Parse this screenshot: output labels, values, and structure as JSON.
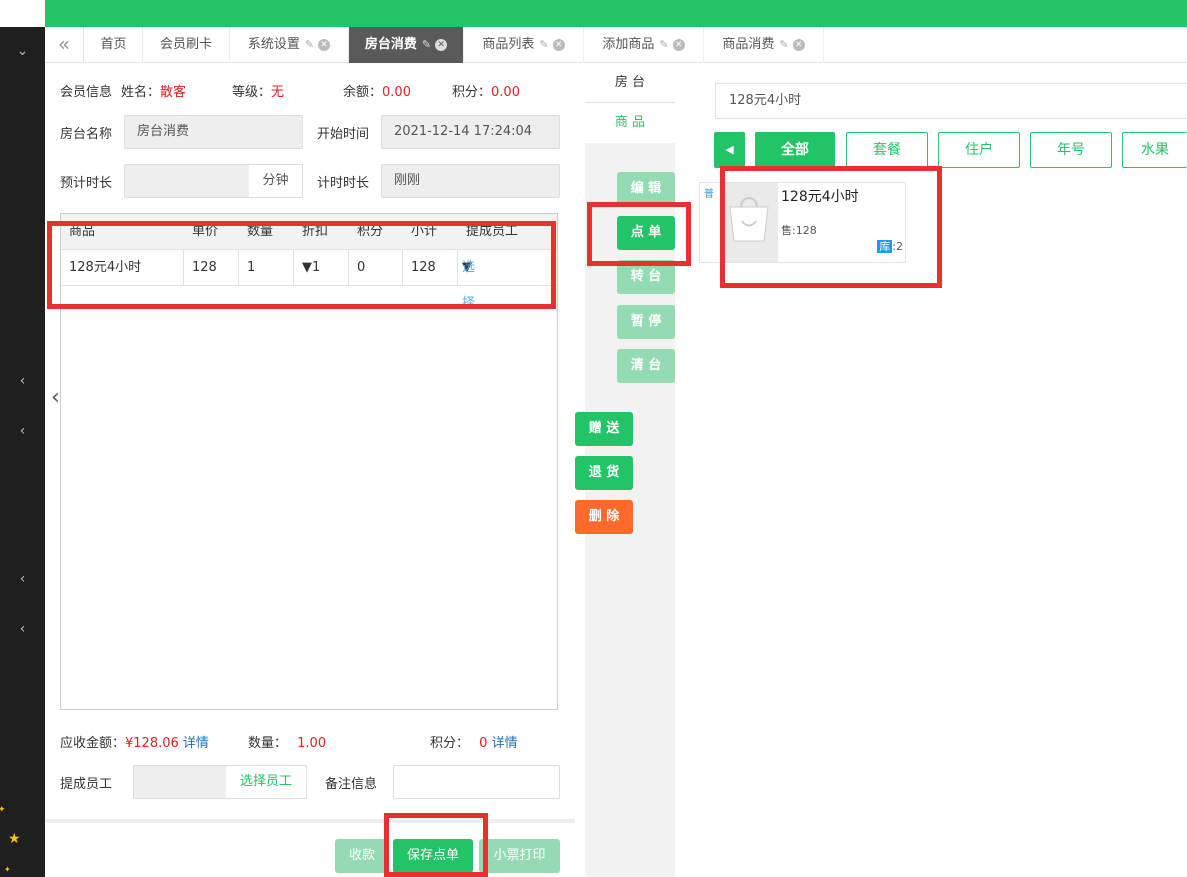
{
  "tabs": {
    "back_icon": "double-chevron-left-icon",
    "items": [
      {
        "label": "首页",
        "pinned": false,
        "closable": false
      },
      {
        "label": "会员刷卡",
        "pinned": false,
        "closable": false
      },
      {
        "label": "系统设置",
        "pinned": true,
        "closable": true
      },
      {
        "label": "房台消费",
        "pinned": true,
        "closable": true,
        "active": true
      },
      {
        "label": "商品列表",
        "pinned": true,
        "closable": true
      },
      {
        "label": "添加商品",
        "pinned": true,
        "closable": true
      },
      {
        "label": "商品消费",
        "pinned": true,
        "closable": true
      }
    ]
  },
  "member": {
    "info_label": "会员信息",
    "name_label": "姓名：",
    "name_value": "散客",
    "level_label": "等级：",
    "level_value": "无",
    "balance_label": "余额：",
    "balance_value": "0.00",
    "points_label": "积分：",
    "points_value": "0.00"
  },
  "room": {
    "name_label": "房台名称",
    "name_value": "房台消费",
    "start_label": "开始时间",
    "start_value": "2021-12-14 17:24:04",
    "expected_label": "预计时长",
    "expected_value": "",
    "expected_unit": "分钟",
    "elapsed_label": "计时时长",
    "elapsed_value": "刚刚"
  },
  "grid": {
    "columns": [
      "商品",
      "单价",
      "数量",
      "折扣",
      "积分",
      "小计",
      "提成员工"
    ],
    "rows": [
      {
        "product": "128元4小时",
        "price": "128",
        "qty": "1",
        "discount": "▼1",
        "points": "0",
        "subtotal": "128",
        "staff_prefix": "▼",
        "staff_link": "选择"
      }
    ]
  },
  "summary": {
    "due_label": "应收金额：",
    "due_value": "¥128.06",
    "due_detail": "详情",
    "qty_label": "数量：",
    "qty_value": "1.00",
    "points_label": "积分：",
    "points_value": "0",
    "points_detail": "详情",
    "staff_label": "提成员工",
    "staff_button": "选择员工",
    "note_label": "备注信息",
    "note_value": ""
  },
  "actions": {
    "collect": "收款",
    "save_order": "保存点单",
    "print_receipt": "小票打印"
  },
  "middle": {
    "tab_room": "房 台",
    "tab_goods": "商 品",
    "edit": "编 辑",
    "order": "点 单",
    "transfer": "转 台",
    "pause": "暂 停",
    "clear": "清 台",
    "gift": "赠 送",
    "return": "退 货",
    "delete": "删 除"
  },
  "products": {
    "search_value": "128元4小时",
    "categories": [
      "全部",
      "套餐",
      "住户",
      "年号",
      "水果"
    ],
    "active_category": "全部",
    "items": [
      {
        "tag": "普",
        "name": "128元4小时",
        "price_label": "售:128",
        "stock_label": "库",
        "stock_value": ":2",
        "icon": "shopping-bag-icon"
      }
    ]
  },
  "colors": {
    "brand_green": "#22c467",
    "warn_orange": "#ff6a2c",
    "price_red": "#e02020",
    "link_blue": "#1e6fb8",
    "highlight_red": "#e8312f"
  }
}
